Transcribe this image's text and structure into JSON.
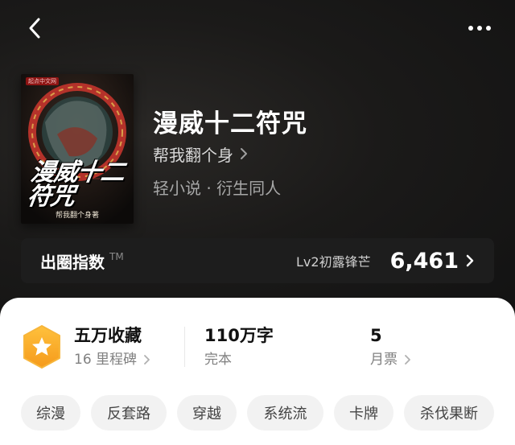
{
  "header": {
    "back_icon": "chevron-left-icon",
    "more_icon": "more-dots-icon"
  },
  "book": {
    "title": "漫威十二符咒",
    "author": "帮我翻个身",
    "genre": "轻小说 · 衍生同人",
    "cover": {
      "title_text": "漫威十二符咒",
      "author_text": "帮我翻个身著",
      "publisher_tag": "起点中文网"
    }
  },
  "index_bar": {
    "label": "出圈指数",
    "trademark": "TM",
    "level": "Lv2初露锋芒",
    "score": "6,461"
  },
  "stats": {
    "collection": {
      "main": "五万收藏",
      "sub": "16 里程碑"
    },
    "words": {
      "main": "110万字",
      "sub": "完本"
    },
    "tickets": {
      "main": "5",
      "sub": "月票"
    }
  },
  "tags": [
    "综漫",
    "反套路",
    "穿越",
    "系统流",
    "卡牌",
    "杀伐果断"
  ],
  "colors": {
    "accent": "#F5A623",
    "hero_bg": "#1a1a1a",
    "panel_bg": "#ffffff",
    "tag_bg": "#f2f2f2"
  }
}
